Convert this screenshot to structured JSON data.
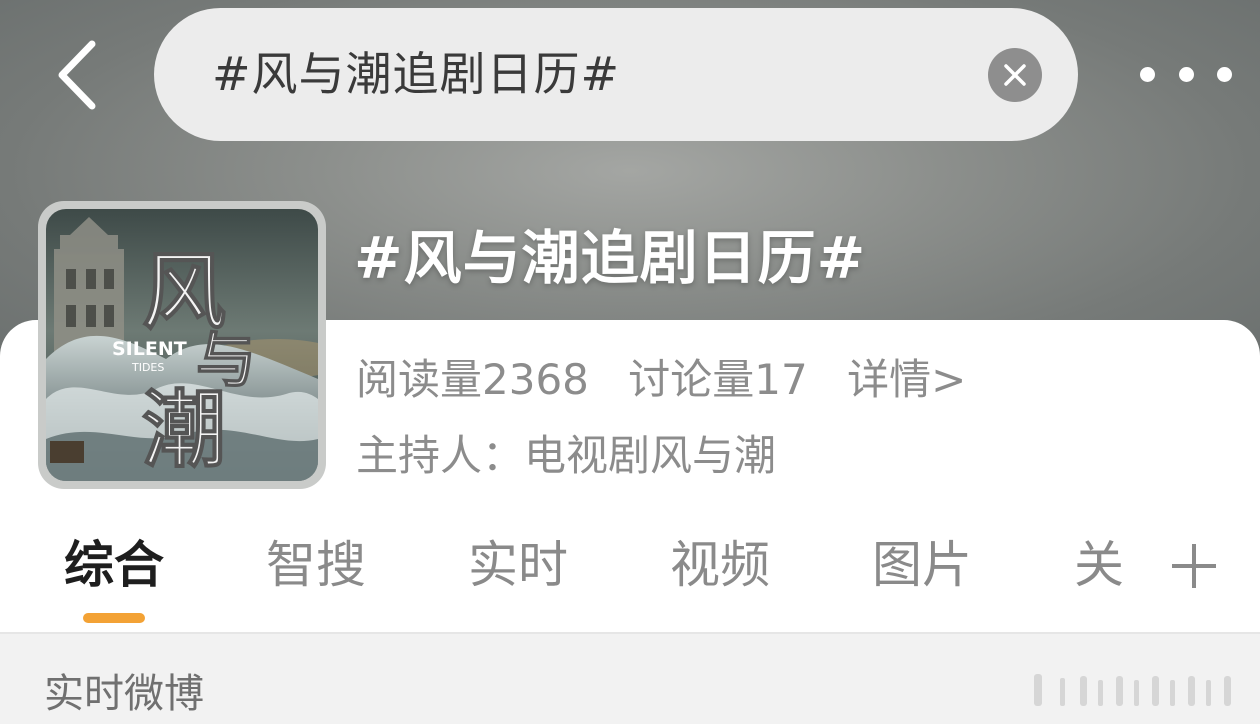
{
  "header": {
    "search_text": "#风与潮追剧日历#",
    "back_icon": "chevron-left-icon",
    "clear_icon": "clear-x-icon",
    "more_icon": "more-dots-icon"
  },
  "topic": {
    "title": "#风与潮追剧日历#",
    "poster": {
      "title_chars": "风与潮",
      "english_title": "SILENT TIDES",
      "english_line1": "SILENT",
      "english_line2": "TIDES"
    },
    "reads": "阅读量2368",
    "discussions": "讨论量17",
    "details_link": "详情>",
    "host": "主持人：电视剧风与潮"
  },
  "tabs": [
    {
      "label": "综合",
      "active": true
    },
    {
      "label": "智搜",
      "active": false
    },
    {
      "label": "实时",
      "active": false
    },
    {
      "label": "视频",
      "active": false
    },
    {
      "label": "图片",
      "active": false
    },
    {
      "label": "关",
      "active": false
    }
  ],
  "tab_add_icon": "plus-icon",
  "section": {
    "label": "实时微博"
  },
  "colors": {
    "accent": "#f3a235",
    "hero_bg": "#8c8f8c",
    "text_primary": "#1e1e1e",
    "text_secondary": "#8c8c8c"
  }
}
